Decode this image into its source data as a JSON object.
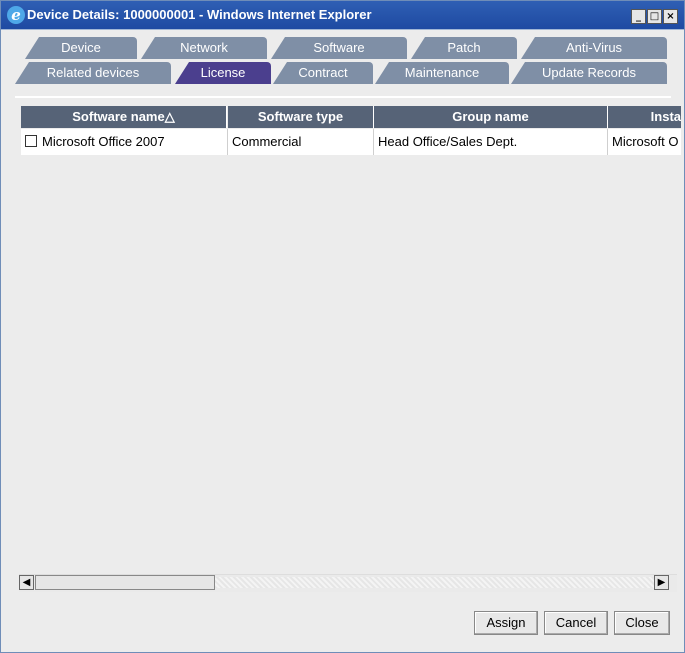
{
  "window": {
    "title": "Device Details: 1000000001 - Windows Internet Explorer"
  },
  "tabs_row1": [
    "Device",
    "Network",
    "Software",
    "Patch",
    "Anti-Virus"
  ],
  "tabs_row2": [
    "Related devices",
    "License",
    "Contract",
    "Maintenance",
    "Update Records"
  ],
  "active_tab": "License",
  "table": {
    "headers": [
      "Software name",
      "Software type",
      "Group name",
      "Insta"
    ],
    "sort_indicator": "△",
    "rows": [
      [
        "Microsoft Office 2007",
        "Commercial",
        "Head Office/Sales Dept.",
        "Microsoft O"
      ]
    ]
  },
  "buttons": {
    "assign": "Assign",
    "cancel": "Cancel",
    "close": "Close"
  },
  "colors": {
    "tab": "#7f8fa6",
    "tab_active": "#4b3f8e",
    "header": "#566377",
    "titlebar": "#2f5fb4"
  }
}
